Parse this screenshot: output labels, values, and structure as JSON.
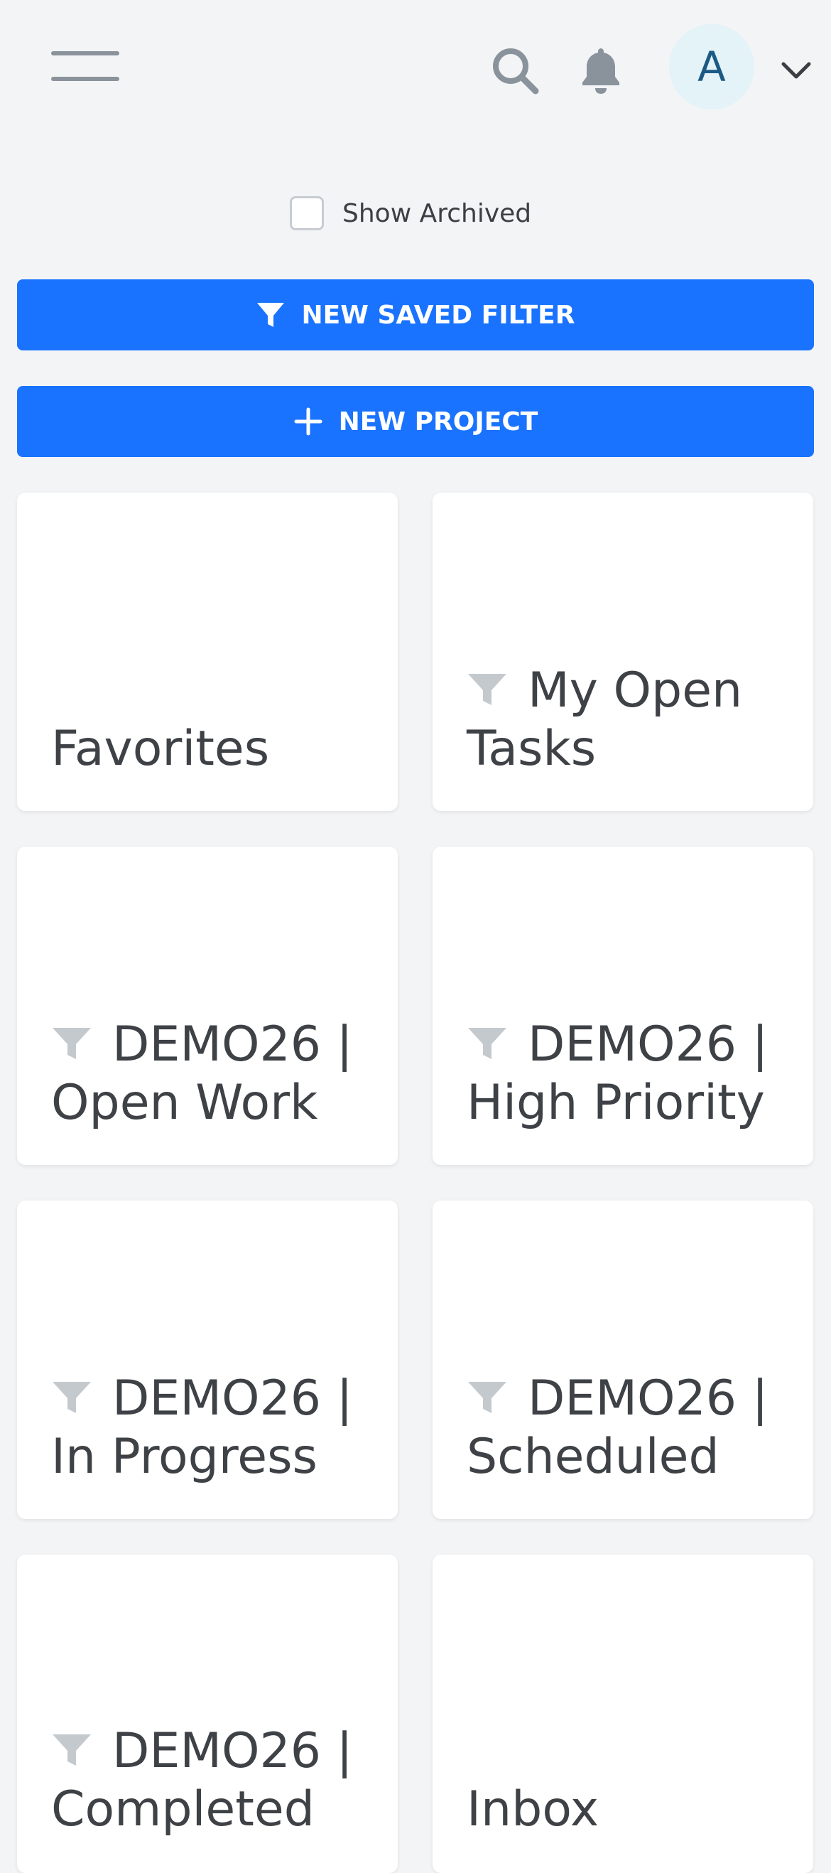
{
  "header": {
    "menu_icon": "hamburger-menu-icon",
    "search_icon": "search-icon",
    "notifications_icon": "bell-icon",
    "avatar_initial": "A",
    "account_menu_icon": "chevron-down-icon"
  },
  "show_archived": {
    "label": "Show Archived",
    "checked": false
  },
  "buttons": {
    "new_saved_filter": "NEW SAVED FILTER",
    "new_saved_filter_icon": "filter-icon",
    "new_project": "NEW PROJECT",
    "new_project_icon": "plus-icon"
  },
  "cards": [
    {
      "title": "Favorites",
      "is_filter": false
    },
    {
      "title": "My Open Tasks",
      "is_filter": true
    },
    {
      "title": "DEMO26 | Open Work",
      "is_filter": true
    },
    {
      "title": "DEMO26 | High Priority",
      "is_filter": true
    },
    {
      "title": "DEMO26 | In Progress",
      "is_filter": true
    },
    {
      "title": "DEMO26 | Scheduled",
      "is_filter": true
    },
    {
      "title": "DEMO26 | Completed",
      "is_filter": true
    },
    {
      "title": "Inbox",
      "is_filter": false
    }
  ],
  "colors": {
    "background": "#f3f4f6",
    "primary": "#1973ff",
    "card": "#ffffff",
    "text": "#3e4246",
    "icon_muted": "#8a939b",
    "filter_icon": "#c4c9ce",
    "avatar_bg": "#e3f3f8",
    "avatar_text": "#1c5a84"
  }
}
